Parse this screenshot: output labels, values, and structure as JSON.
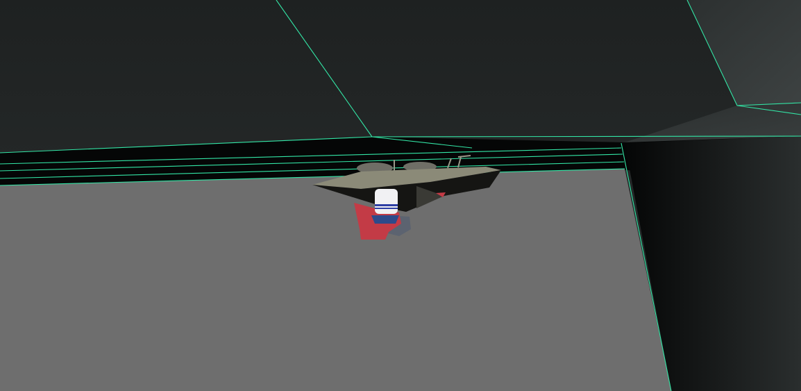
{
  "scene": {
    "colors": {
      "sky_top": "#1e2121",
      "sky_mid": "#2c3030",
      "sky_light": "#3d4242",
      "floor": "#6e6e6e",
      "wall_dark": "#050606",
      "wall_right": "#2a2e2e",
      "wireframe": "#33e6a6",
      "boat_hull": "#8b8a78",
      "boat_shadow": "#151513",
      "character_body": "#c33b46",
      "character_head": "#f1f1f3",
      "character_stripe": "#2e3fa4",
      "character_shadow": "#5c6370"
    },
    "objects": [
      {
        "name": "floor-plane",
        "type": "ground"
      },
      {
        "name": "ceiling-panels",
        "type": "geometry"
      },
      {
        "name": "right-wall",
        "type": "geometry"
      },
      {
        "name": "boat",
        "type": "vehicle"
      },
      {
        "name": "player-character",
        "type": "avatar"
      }
    ]
  }
}
